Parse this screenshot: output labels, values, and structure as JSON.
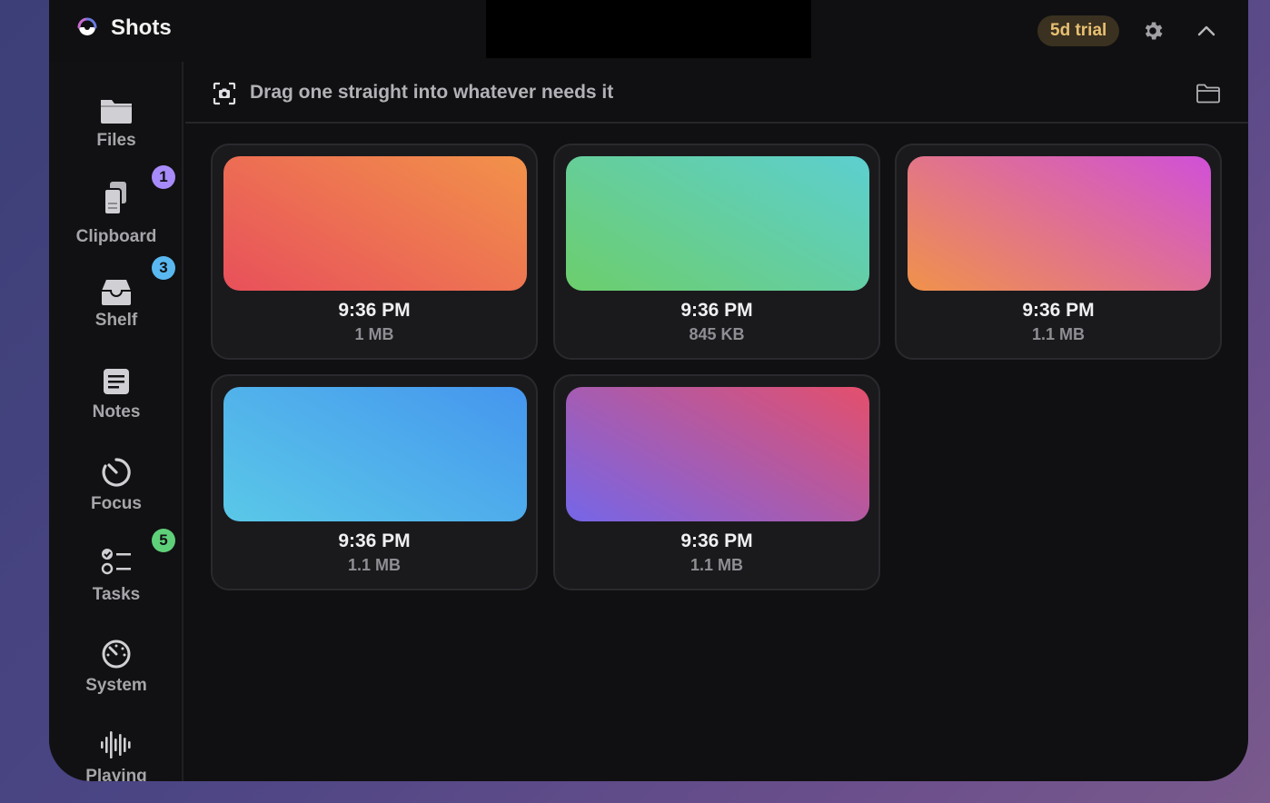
{
  "app": {
    "name": "Shots",
    "trial_label": "5d trial"
  },
  "hint": {
    "text": "Drag one straight into whatever needs it"
  },
  "nav": [
    {
      "label": "Files",
      "icon": "folder-icon",
      "badge": ""
    },
    {
      "label": "Clipboard",
      "icon": "clipboard-icon",
      "badge": "1",
      "badge_color": "#a78bfa"
    },
    {
      "label": "Shelf",
      "icon": "tray-icon",
      "badge": "3",
      "badge_color": "#5ab8f0"
    },
    {
      "label": "Notes",
      "icon": "note-icon",
      "badge": ""
    },
    {
      "label": "Focus",
      "icon": "timer-icon",
      "badge": ""
    },
    {
      "label": "Tasks",
      "icon": "checklist-icon",
      "badge": "5",
      "badge_color": "#5fd07a"
    },
    {
      "label": "System",
      "icon": "gauge-icon",
      "badge": ""
    },
    {
      "label": "Playing",
      "icon": "waveform-icon",
      "badge": ""
    }
  ],
  "shots": [
    {
      "time": "9:36 PM",
      "size": "1 MB",
      "gradient": [
        "#e8505b",
        "#f2924a"
      ]
    },
    {
      "time": "9:36 PM",
      "size": "845 KB",
      "gradient": [
        "#6cce6c",
        "#5dcfd0"
      ]
    },
    {
      "time": "9:36 PM",
      "size": "1.1 MB",
      "gradient": [
        "#f0924a",
        "#d050d8"
      ]
    },
    {
      "time": "9:36 PM",
      "size": "1.1 MB",
      "gradient": [
        "#5ac8e8",
        "#4596ee"
      ]
    },
    {
      "time": "9:36 PM",
      "size": "1.1 MB",
      "gradient": [
        "#7566e8",
        "#e44f6c"
      ]
    }
  ]
}
